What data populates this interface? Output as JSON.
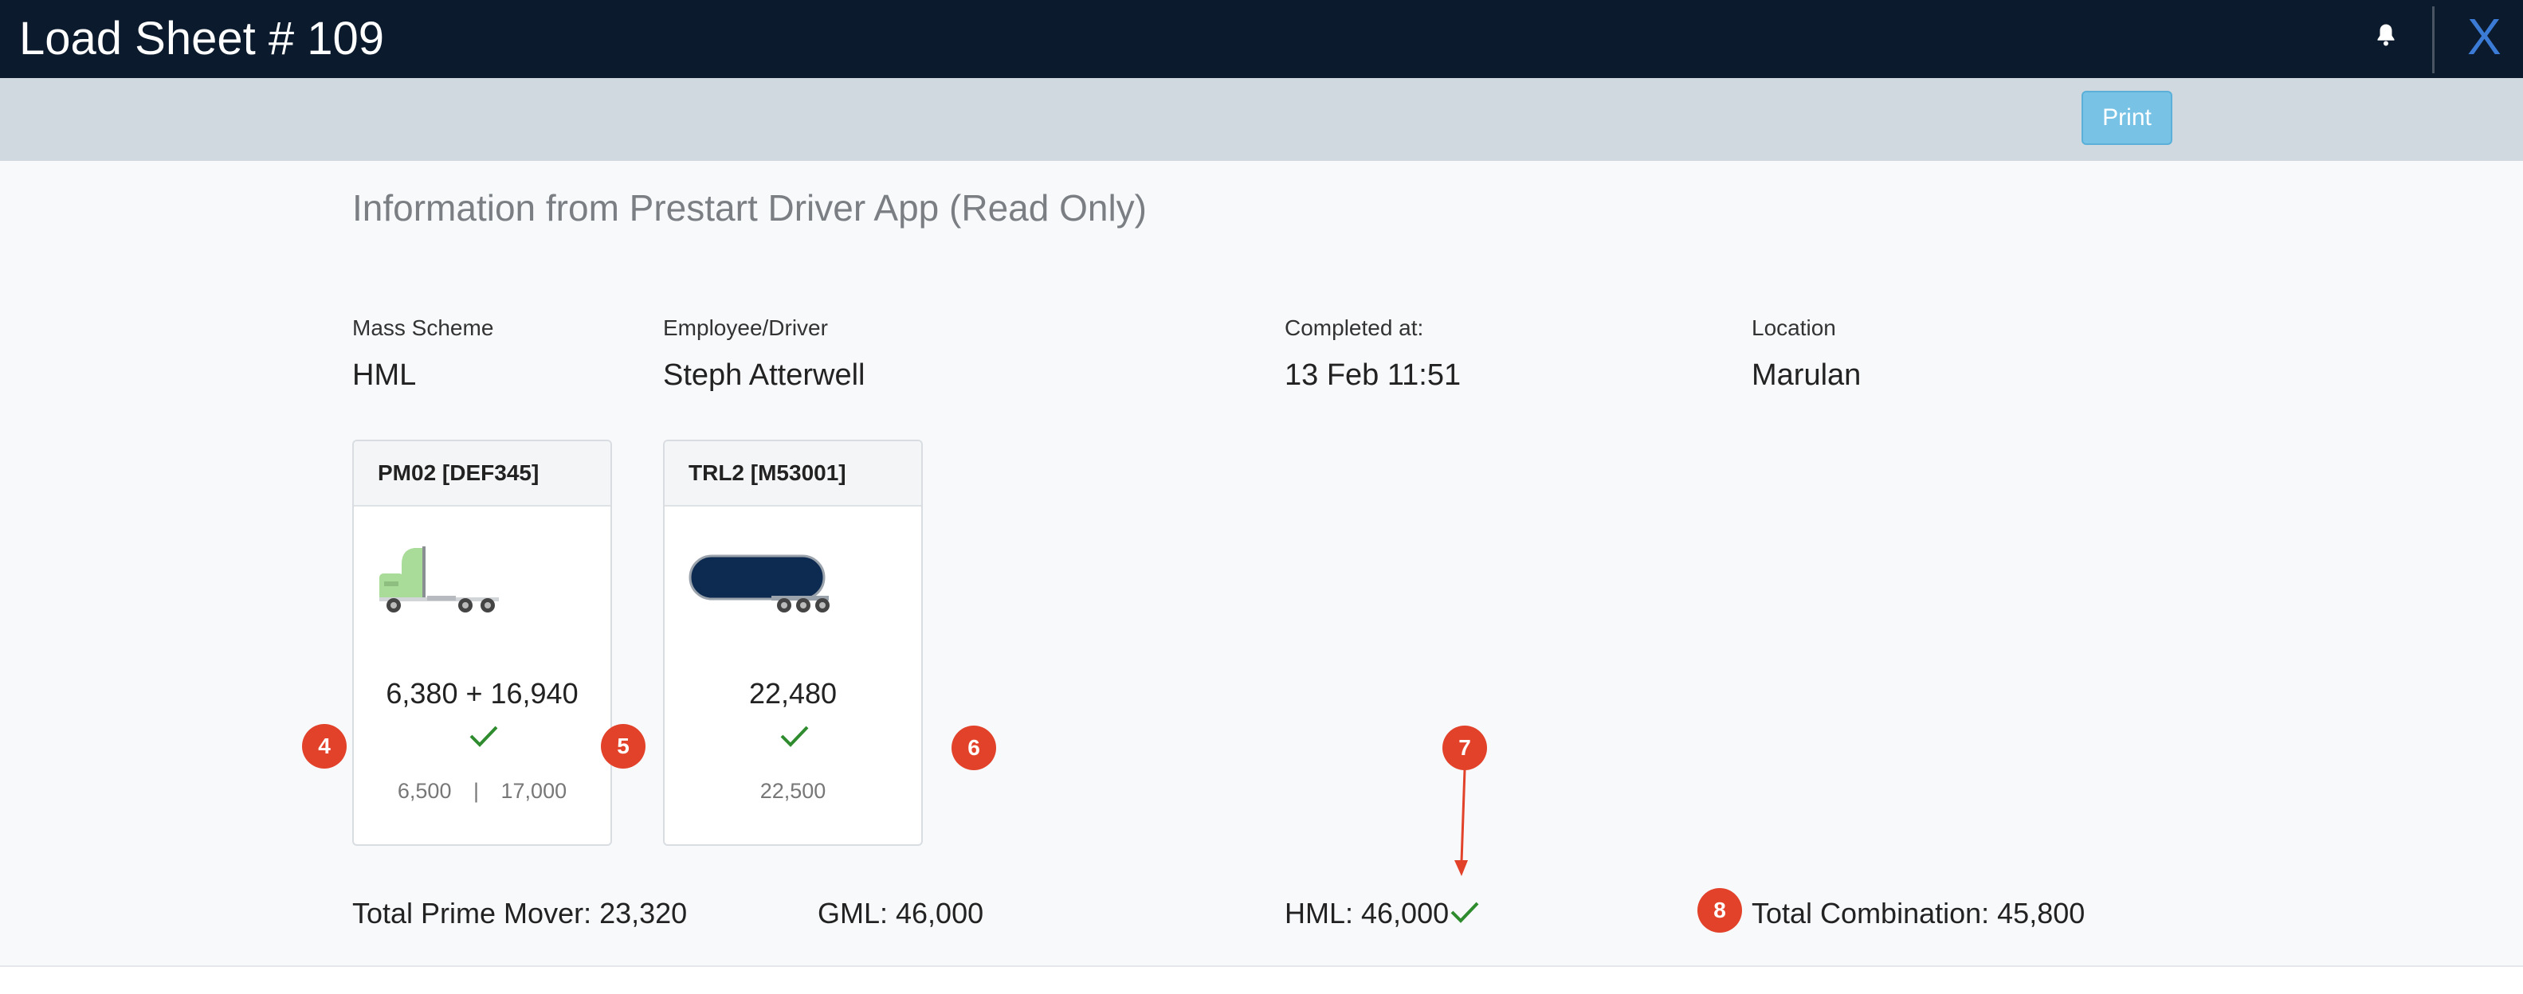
{
  "header": {
    "title": "Load Sheet # 109",
    "close_label": "X",
    "bell_icon": "bell-icon"
  },
  "toolbar": {
    "print_label": "Print"
  },
  "info": {
    "section_title": "Information from Prestart Driver App (Read Only)",
    "mass_scheme_label": "Mass Scheme",
    "mass_scheme_value": "HML",
    "driver_label": "Employee/Driver",
    "driver_value": "Steph Atterwell",
    "completed_label": "Completed at:",
    "completed_value": "13 Feb 11:51",
    "location_label": "Location",
    "location_value": "Marulan"
  },
  "cards": [
    {
      "title": "PM02 [DEF345]",
      "icon": "prime-mover-truck-icon",
      "weight": "6,380 + 16,940",
      "limit_a": "6,500",
      "limit_sep": "|",
      "limit_b": "17,000"
    },
    {
      "title": "TRL2 [M53001]",
      "icon": "tanker-trailer-icon",
      "weight": "22,480",
      "limit": "22,500"
    }
  ],
  "badges": [
    "4",
    "5",
    "6",
    "7",
    "8"
  ],
  "totals": {
    "prime_mover": "Total Prime Mover: 23,320",
    "gml": "GML: 46,000",
    "hml": "HML: 46,000",
    "combination": "Total Combination: 45,800"
  },
  "colors": {
    "header_bg": "#0b1a2c",
    "toolbar_bg": "#d1d9e0",
    "print_button": "#78c2e6",
    "badge": "#e2422a",
    "check": "#2e8b2e",
    "close": "#3b7bd6"
  }
}
